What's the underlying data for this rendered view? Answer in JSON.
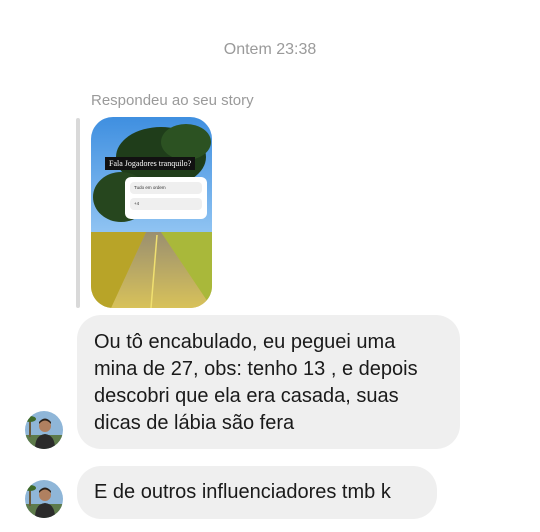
{
  "timestamp": "Ontem 23:38",
  "reply_label": "Respondeu ao seu story",
  "story": {
    "question": "Fala Jogadores tranquilo?",
    "options": [
      "Tudo em ordem",
      "+4"
    ]
  },
  "messages": [
    {
      "text": "Ou tô encabulado, eu peguei uma mina de 27, obs: tenho 13 , e depois descobri que ela era casada, suas dicas de lábia são fera"
    },
    {
      "text": "E de outros influenciadores tmb k"
    }
  ],
  "colors": {
    "bubble": "#efefef",
    "timestamp": "#9a9a9a"
  }
}
